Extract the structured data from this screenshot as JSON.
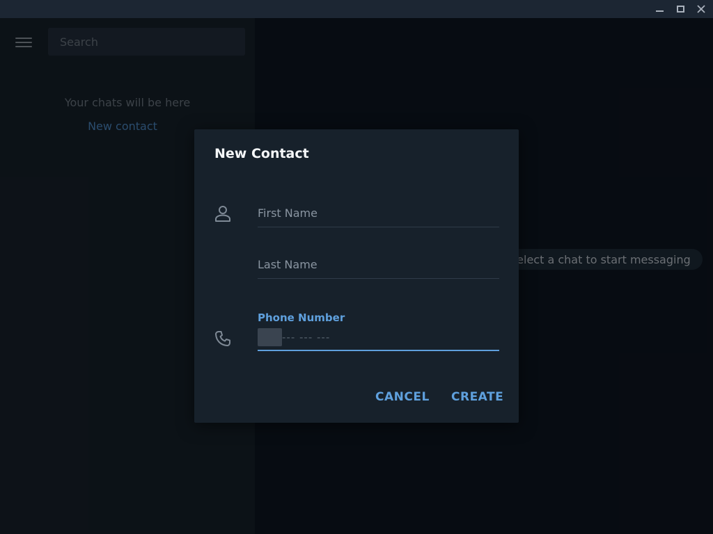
{
  "sidebar": {
    "search_placeholder": "Search",
    "empty_text": "Your chats will be here",
    "new_contact_link": "New contact"
  },
  "main": {
    "start_messaging": "Select a chat to start messaging"
  },
  "dialog": {
    "title": "New Contact",
    "first_name_placeholder": "First Name",
    "last_name_placeholder": "Last Name",
    "phone_label": "Phone Number",
    "phone_placeholder": "--- --- ---",
    "cancel_label": "CANCEL",
    "create_label": "CREATE"
  },
  "colors": {
    "background": "#0e1621",
    "sidebar": "#17212b",
    "accent": "#5fa0dd",
    "link": "#4e8ac6"
  },
  "icons": [
    "minimize-icon",
    "maximize-icon",
    "close-icon",
    "menu-icon",
    "person-icon",
    "phone-icon"
  ]
}
